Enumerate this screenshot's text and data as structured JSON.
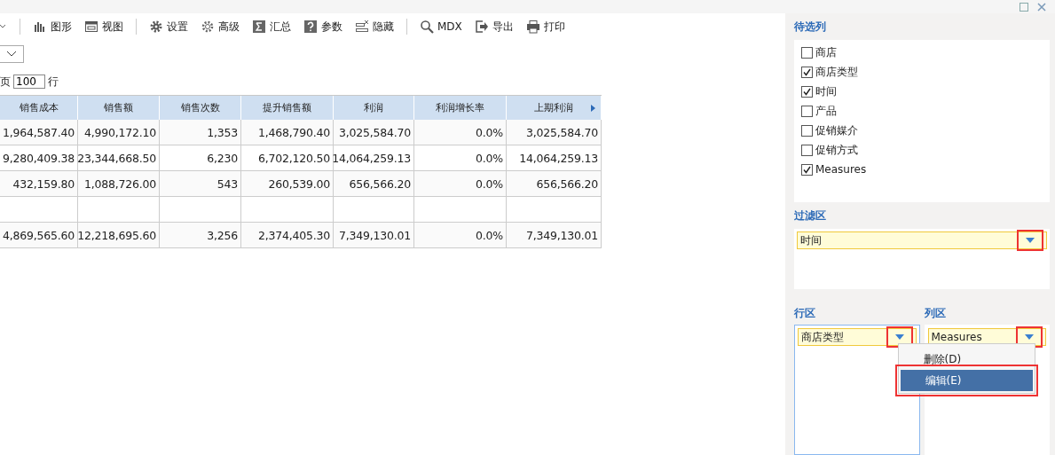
{
  "toolbar": [
    {
      "kind": "bars",
      "label": "图形"
    },
    {
      "kind": "view",
      "label": "视图"
    },
    {
      "kind": "gear",
      "label": "设置"
    },
    {
      "kind": "gear-outline",
      "label": "高级"
    },
    {
      "kind": "sigma",
      "label": "汇总"
    },
    {
      "kind": "question",
      "label": "参数"
    },
    {
      "kind": "hide",
      "label": "隐藏"
    },
    {
      "kind": "search",
      "label": "MDX"
    },
    {
      "kind": "export",
      "label": "导出"
    },
    {
      "kind": "print",
      "label": "打印"
    }
  ],
  "paging": {
    "prefix": "页",
    "value": "100",
    "suffix": "行"
  },
  "table": {
    "columns": [
      "销售成本",
      "销售额",
      "销售次数",
      "提升销售额",
      "利润",
      "利润增长率",
      "上期利润"
    ],
    "rows": [
      [
        "1,964,587.40",
        "4,990,172.10",
        "1,353",
        "1,468,790.40",
        "3,025,584.70",
        "0.0%",
        "3,025,584.70"
      ],
      [
        "9,280,409.38",
        "23,344,668.50",
        "6,230",
        "6,702,120.50",
        "14,064,259.13",
        "0.0%",
        "14,064,259.13"
      ],
      [
        "432,159.80",
        "1,088,726.00",
        "543",
        "260,539.00",
        "656,566.20",
        "0.0%",
        "656,566.20"
      ],
      [],
      [
        "4,869,565.60",
        "12,218,695.60",
        "3,256",
        "2,374,405.30",
        "7,349,130.01",
        "0.0%",
        "7,349,130.01"
      ]
    ]
  },
  "candidates": {
    "title": "待选列",
    "items": [
      {
        "label": "商店",
        "checked": false
      },
      {
        "label": "商店类型",
        "checked": true
      },
      {
        "label": "时间",
        "checked": true
      },
      {
        "label": "产品",
        "checked": false
      },
      {
        "label": "促销媒介",
        "checked": false
      },
      {
        "label": "促销方式",
        "checked": false
      },
      {
        "label": "Measures",
        "checked": true
      }
    ]
  },
  "filter": {
    "title": "过滤区",
    "fields": [
      {
        "label": "时间",
        "highlighted": true
      }
    ]
  },
  "rows_area": {
    "title": "行区",
    "focused": true,
    "fields": [
      {
        "label": "商店类型",
        "highlighted": true
      }
    ]
  },
  "columns_area": {
    "title": "列区",
    "focused": false,
    "fields": [
      {
        "label": "Measures",
        "highlighted": true
      }
    ]
  },
  "context_menu": {
    "items": [
      {
        "label": "删除(D)",
        "selected": false,
        "highlighted": false
      },
      {
        "label": "编辑(E)",
        "selected": true,
        "highlighted": true
      }
    ]
  }
}
